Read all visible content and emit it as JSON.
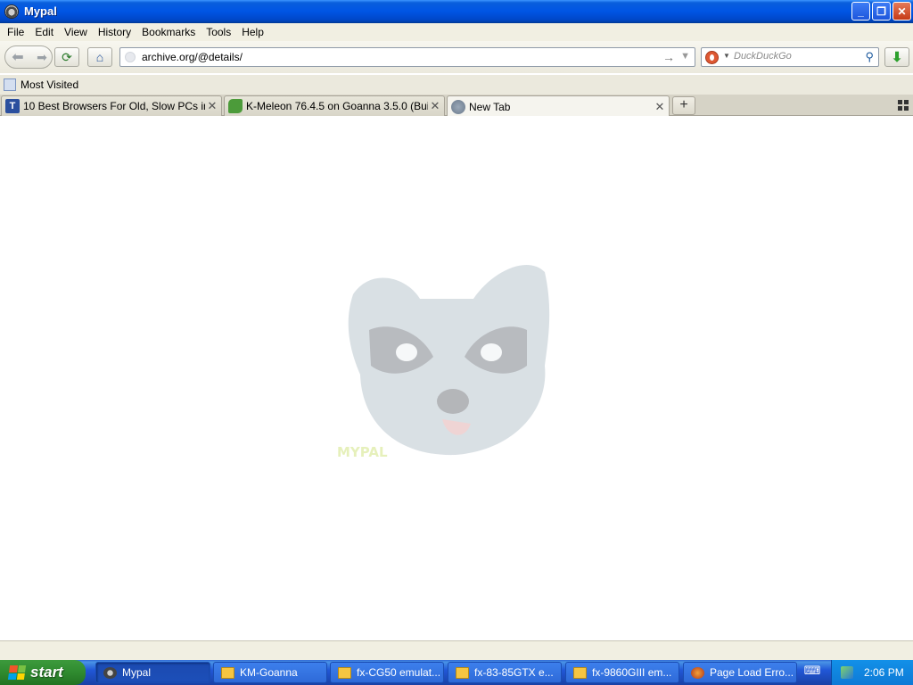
{
  "window": {
    "title": "Mypal"
  },
  "menu": [
    "File",
    "Edit",
    "View",
    "History",
    "Bookmarks",
    "Tools",
    "Help"
  ],
  "navbar": {
    "url": "archive.org/@details/",
    "search_placeholder": "DuckDuckGo"
  },
  "bookmarks": {
    "most_visited": "Most Visited"
  },
  "tabs": [
    {
      "title": "10 Best Browsers For Old, Slow PCs in 20...",
      "icon": "tv-site-icon",
      "active": false
    },
    {
      "title": "K-Meleon 76.4.5 on Goanna 3.5.0 (Build ...",
      "icon": "kmeleon-icon",
      "active": false
    },
    {
      "title": "New Tab",
      "icon": "globe-icon",
      "active": true
    }
  ],
  "content": {
    "logo": "mypal-raccoon-logo",
    "logo_text": "MYPAL"
  },
  "taskbar": {
    "start_label": "start",
    "tasks": [
      {
        "label": "Mypal",
        "active": true
      },
      {
        "label": "KM-Goanna",
        "active": false
      },
      {
        "label": "fx-CG50 emulat...",
        "active": false
      },
      {
        "label": "fx-83-85GTX e...",
        "active": false
      },
      {
        "label": "fx-9860GIII em...",
        "active": false
      },
      {
        "label": "Page Load Erro...",
        "active": false
      }
    ],
    "clock": "2:06 PM"
  },
  "colors": {
    "titlebar": "#0055e5",
    "taskbar": "#2157d7",
    "start": "#2f8a2f",
    "chrome": "#ebe9dd"
  }
}
